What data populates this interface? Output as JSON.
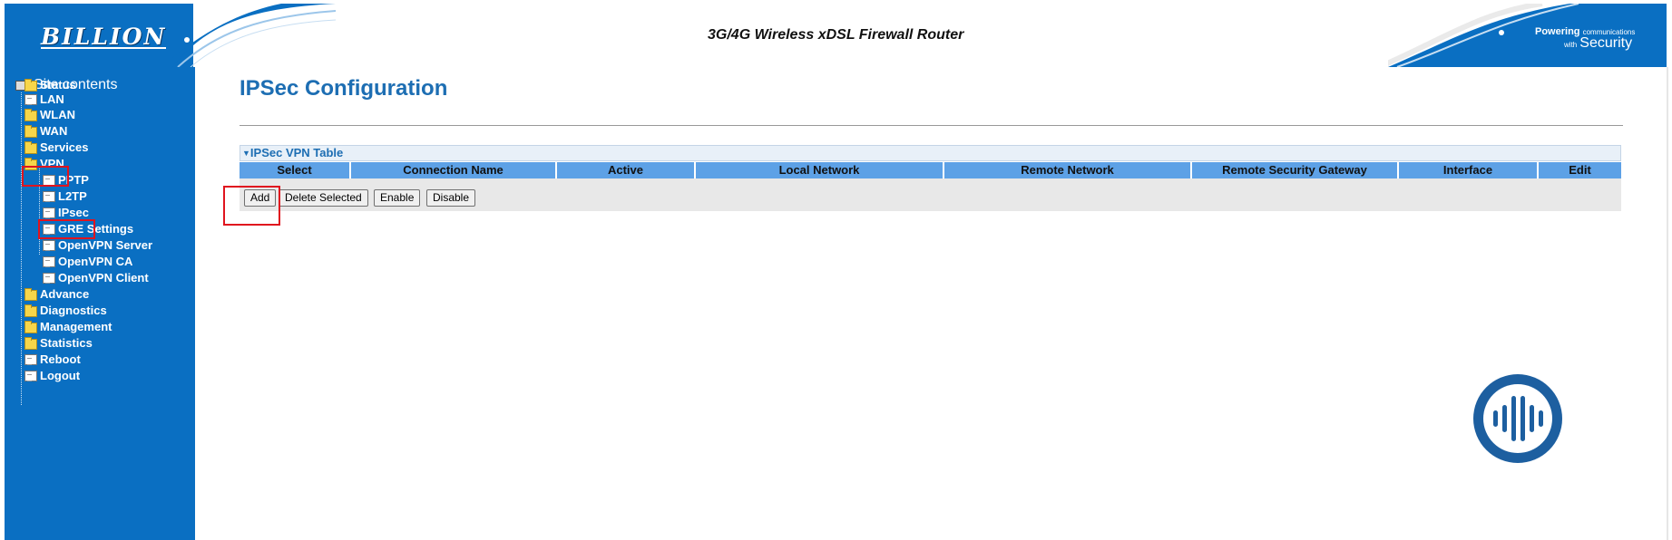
{
  "header": {
    "brand": "BILLION",
    "product_title": "3G/4G Wireless xDSL Firewall Router",
    "tagline_word": "Powering",
    "tagline_small": "communications",
    "tagline_with": "with",
    "tagline_big": "Security"
  },
  "sidebar": {
    "root_label": "Site contents",
    "items": [
      {
        "label": "Status",
        "icon": "folder-icon"
      },
      {
        "label": "LAN",
        "icon": "document-icon"
      },
      {
        "label": "WLAN",
        "icon": "folder-icon"
      },
      {
        "label": "WAN",
        "icon": "folder-icon"
      },
      {
        "label": "Services",
        "icon": "folder-icon"
      },
      {
        "label": "VPN",
        "icon": "folder-open-icon"
      },
      {
        "label": "PPTP",
        "icon": "document-icon"
      },
      {
        "label": "L2TP",
        "icon": "document-icon"
      },
      {
        "label": "IPsec",
        "icon": "document-icon"
      },
      {
        "label": "GRE Settings",
        "icon": "document-icon"
      },
      {
        "label": "OpenVPN Server",
        "icon": "document-icon"
      },
      {
        "label": "OpenVPN CA",
        "icon": "document-icon"
      },
      {
        "label": "OpenVPN Client",
        "icon": "document-icon"
      },
      {
        "label": "Advance",
        "icon": "folder-icon"
      },
      {
        "label": "Diagnostics",
        "icon": "folder-icon"
      },
      {
        "label": "Management",
        "icon": "folder-icon"
      },
      {
        "label": "Statistics",
        "icon": "folder-icon"
      },
      {
        "label": "Reboot",
        "icon": "document-icon"
      },
      {
        "label": "Logout",
        "icon": "document-icon"
      }
    ]
  },
  "main": {
    "title": "IPSec Configuration",
    "table": {
      "caption": "IPSec VPN Table",
      "columns": [
        "Select",
        "Connection Name",
        "Active",
        "Local Network",
        "Remote Network",
        "Remote Security Gateway",
        "Interface",
        "Edit"
      ]
    },
    "buttons": {
      "add": "Add",
      "delete_selected": "Delete Selected",
      "enable": "Enable",
      "disable": "Disable"
    }
  },
  "colors": {
    "sidebar_bg": "#0a6fc2",
    "title_blue": "#1d6eb3",
    "table_header_bg": "#5da1e6",
    "highlight_red": "#e0141e"
  }
}
